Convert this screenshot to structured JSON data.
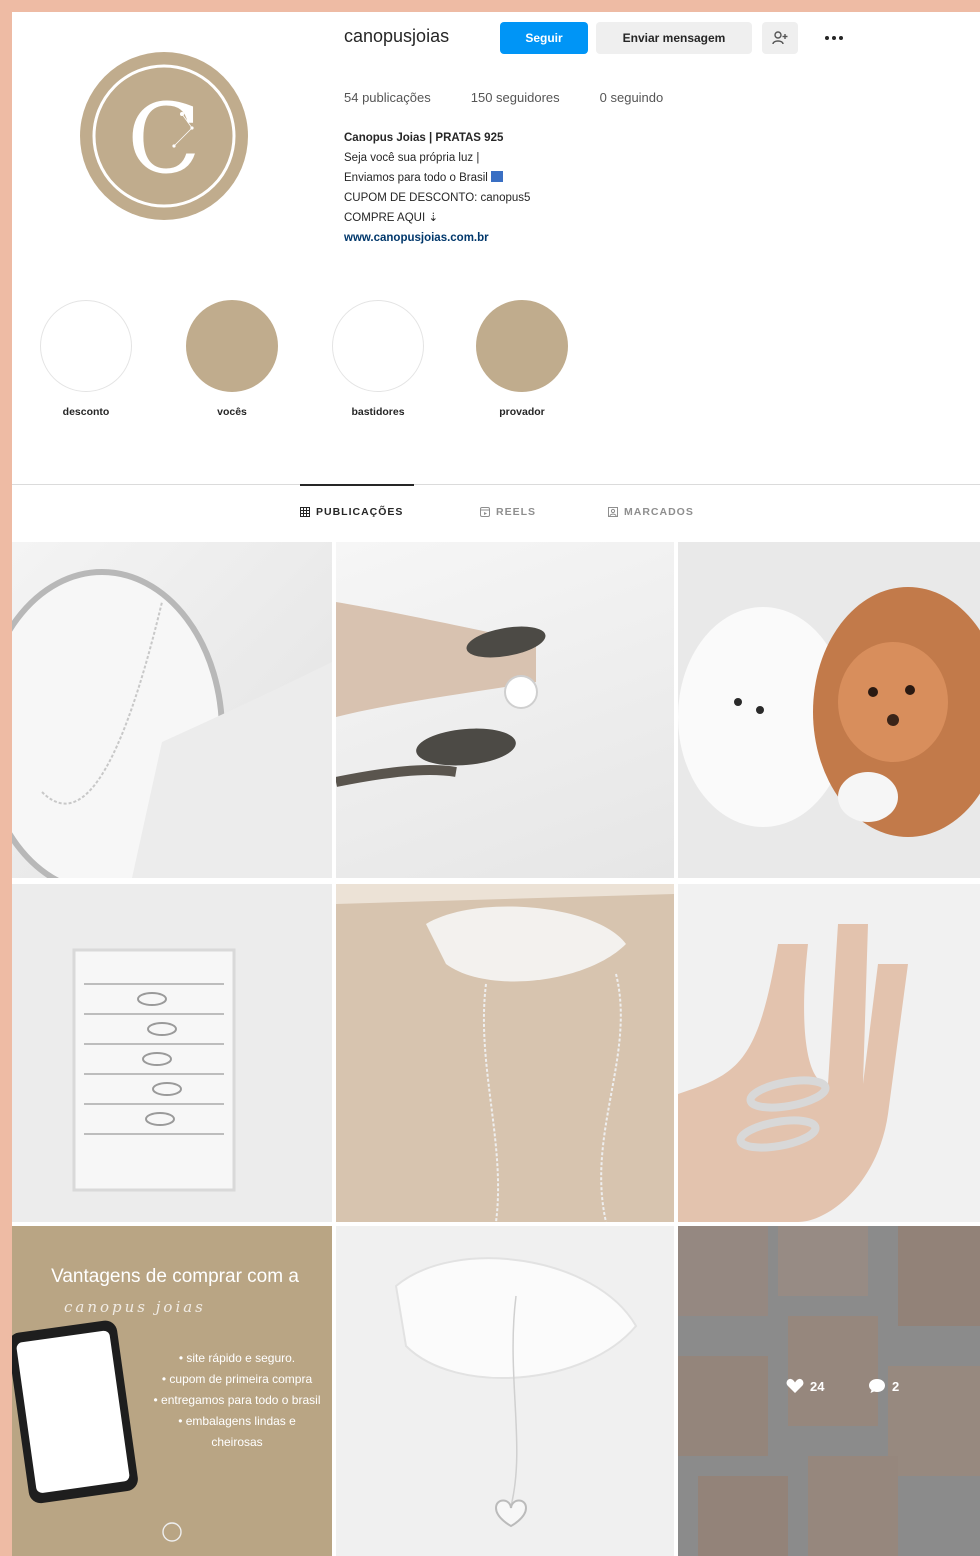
{
  "profile": {
    "username": "canopusjoias",
    "follow_label": "Seguir",
    "message_label": "Enviar mensagem",
    "suggest_icon": "person-plus-icon",
    "more_icon": "more-horizontal-icon",
    "logo_letter": "C",
    "stats": {
      "posts": "54 publicações",
      "followers": "150 seguidores",
      "following": "0 seguindo"
    },
    "bio": {
      "name": "Canopus Joias | PRATAS 925",
      "line1": "Seja você sua própria luz |",
      "line2": "Enviamos para todo o Brasil",
      "line3": "CUPOM DE DESCONTO: canopus5",
      "line4": "COMPRE AQUI ⇣",
      "link": "www.canopusjoias.com.br"
    }
  },
  "highlights": [
    {
      "label": "desconto"
    },
    {
      "label": "vocês"
    },
    {
      "label": "bastidores"
    },
    {
      "label": "provador"
    }
  ],
  "tabs": [
    {
      "label": "PUBLICAÇÕES",
      "icon": "grid-icon"
    },
    {
      "label": "REELS",
      "icon": "reels-icon"
    },
    {
      "label": "MARCADOS",
      "icon": "tag-icon"
    }
  ],
  "promo_post": {
    "title": "Vantagens de comprar com a",
    "brand": "canopus joias",
    "items": [
      "• site rápido e seguro.",
      "• cupom de primeira compra",
      "• entregamos para todo o brasil",
      "• embalagens lindas e cheirosas"
    ]
  },
  "hover_post": {
    "likes": "24",
    "comments": "2"
  },
  "colors": {
    "background_frame": "#eebba4",
    "brand_beige": "#c0ac8d",
    "follow_blue": "#0095f6"
  }
}
